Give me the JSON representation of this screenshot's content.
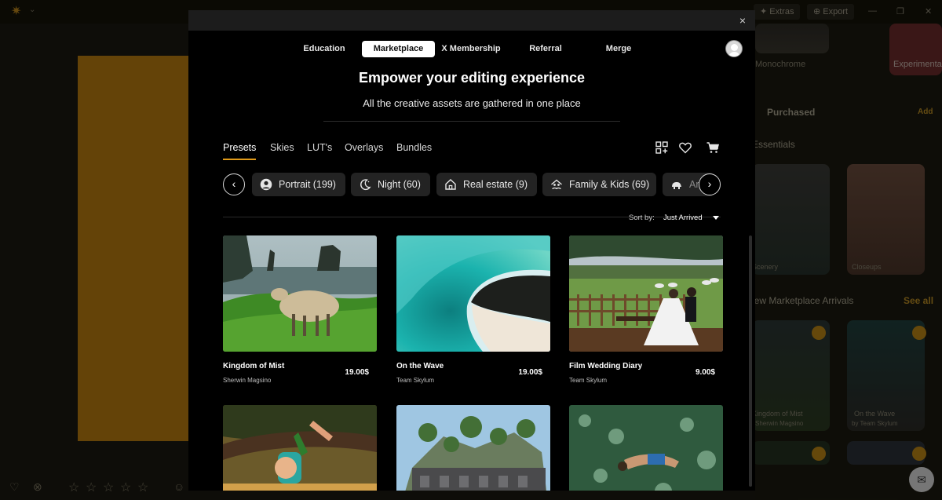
{
  "background_app": {
    "top_buttons": [
      "Extras",
      "Export"
    ],
    "panel": {
      "thumb_labels": [
        "Monochrome",
        "Experimental"
      ],
      "purchased_heading": "Purchased",
      "purchased_action": "Add",
      "essentials_heading": "Essentials",
      "essentials_items": [
        "Scenery",
        "Closeups"
      ],
      "arrivals_heading": "New Marketplace Arrivals",
      "arrivals_action": "See all",
      "arrival_cards": [
        {
          "title": "Kingdom of Mist",
          "author": "Sherwin Magsino"
        },
        {
          "title": "On the Wave",
          "author": "by Team Skylum"
        }
      ]
    }
  },
  "modal": {
    "close_label": "×",
    "nav": [
      {
        "label": "Education",
        "active": false
      },
      {
        "label": "Marketplace",
        "active": true
      },
      {
        "label": "X Membership",
        "active": false
      },
      {
        "label": "Referral",
        "active": false
      },
      {
        "label": "Merge",
        "active": false
      }
    ],
    "hero_title": "Empower your editing experience",
    "hero_subtitle": "All the creative assets are gathered in one place",
    "category_tabs": [
      "Presets",
      "Skies",
      "LUT's",
      "Overlays",
      "Bundles"
    ],
    "active_category": "Presets",
    "tool_icons": [
      "grid-add-icon",
      "heart-icon",
      "cart-icon"
    ],
    "chips": [
      {
        "label": "Portrait (199)",
        "icon": "portrait-icon"
      },
      {
        "label": "Night (60)",
        "icon": "moon-icon"
      },
      {
        "label": "Real estate (9)",
        "icon": "house-icon"
      },
      {
        "label": "Family & Kids (69)",
        "icon": "family-icon"
      },
      {
        "label": "Ar",
        "icon": "animals-icon"
      }
    ],
    "sort": {
      "label": "Sort by:",
      "value": "Just Arrived"
    },
    "cards": [
      {
        "title": "Kingdom of Mist",
        "author": "Sherwin Magsino",
        "price": "19.00$"
      },
      {
        "title": "On the Wave",
        "author": "Team Skylum",
        "price": "19.00$"
      },
      {
        "title": "Film Wedding Diary",
        "author": "Team Skylum",
        "price": "9.00$"
      },
      {
        "title": "",
        "author": "",
        "price": ""
      },
      {
        "title": "",
        "author": "",
        "price": ""
      },
      {
        "title": "",
        "author": "",
        "price": ""
      }
    ]
  },
  "colors": {
    "accent": "#e09a19",
    "modal_bg": "#000000",
    "chip_bg": "#232323"
  }
}
